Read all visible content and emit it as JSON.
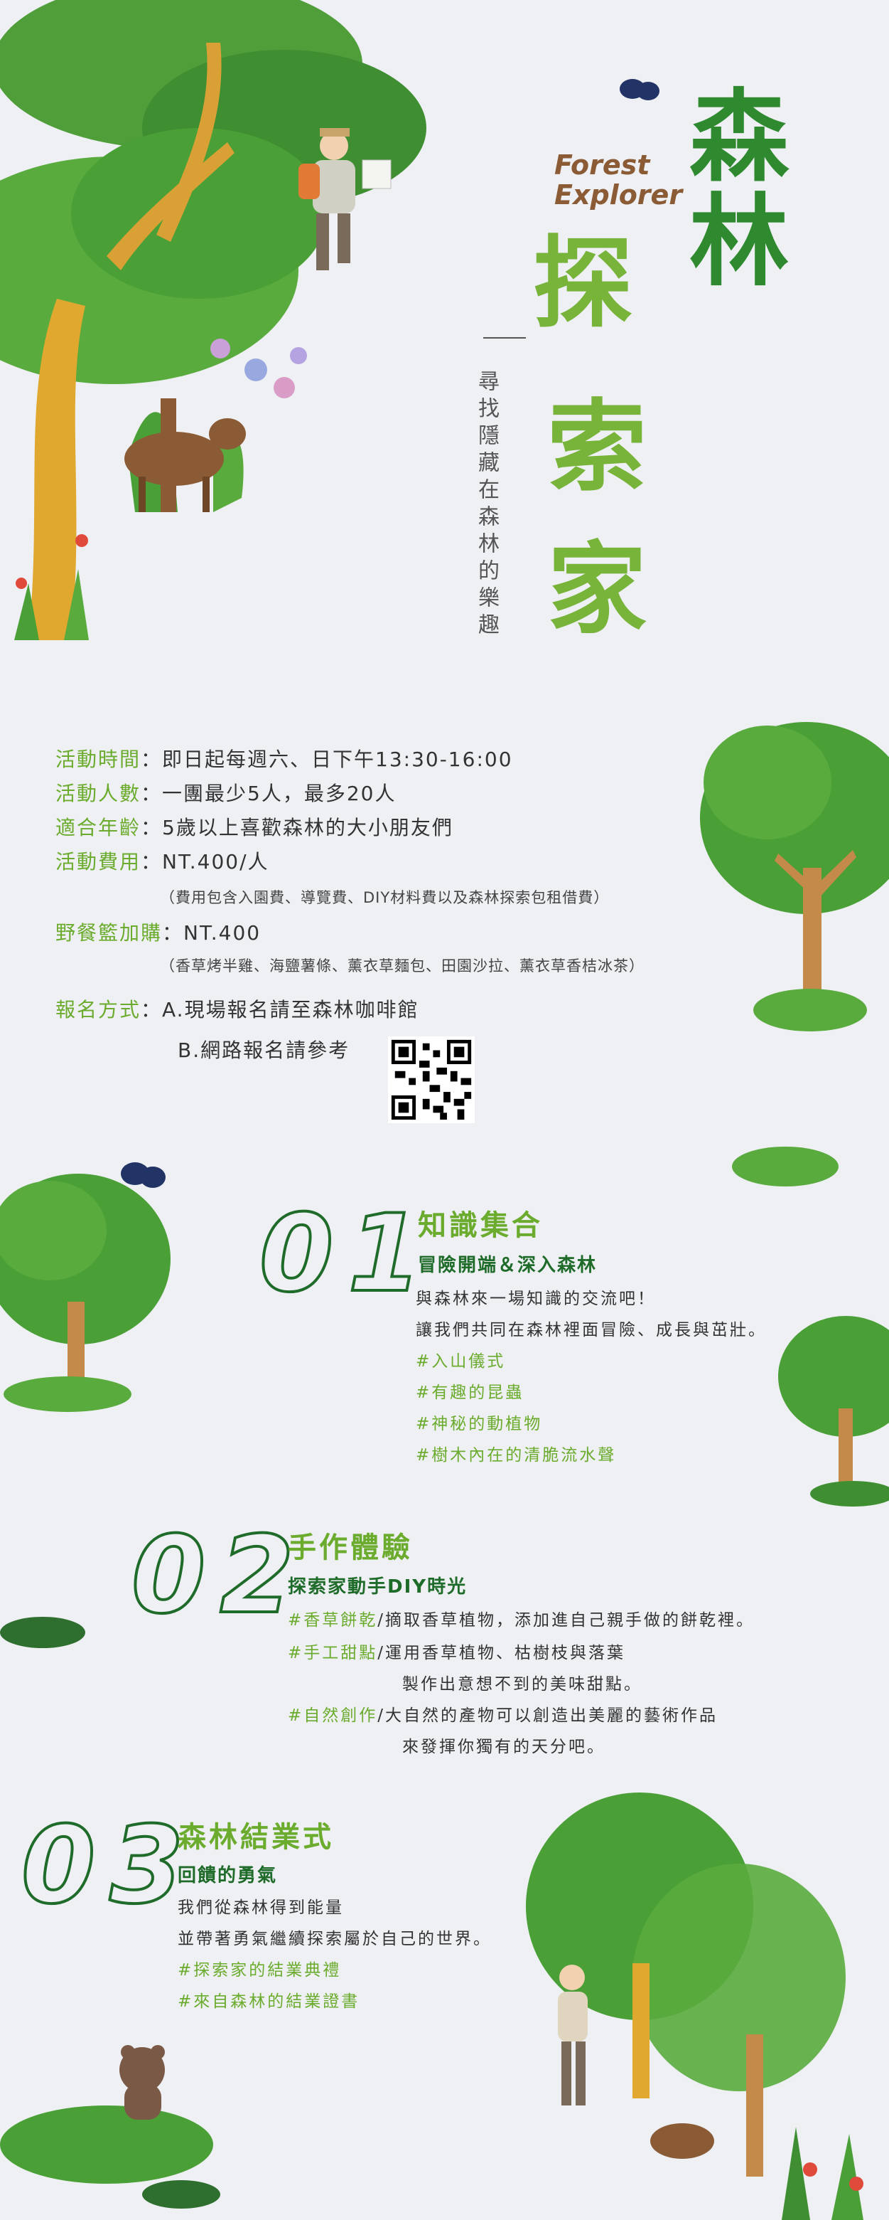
{
  "header": {
    "title_line1": "森林",
    "title_line2a": "探",
    "title_line2b": "索",
    "title_line2c": "家",
    "en_line1": "Forest",
    "en_line2": "Explorer",
    "tagline": "尋找隱藏在森林的樂趣"
  },
  "info": {
    "time_label": "活動時間",
    "time_value": "：即日起每週六、日下午13:30-16:00",
    "people_label": "活動人數",
    "people_value": "：一團最少5人，最多20人",
    "age_label": "適合年齡",
    "age_value": "：5歲以上喜歡森林的大小朋友們",
    "fee_label": "活動費用",
    "fee_value": "：NT.400/人",
    "fee_note": "（費用包含入園費、導覽費、DIY材料費以及森林探索包租借費）",
    "picnic_label": "野餐籃加購",
    "picnic_value": "：NT.400",
    "picnic_note": "（香草烤半雞、海鹽薯條、薰衣草麵包、田園沙拉、薰衣草香桔冰茶）",
    "signup_label": "報名方式",
    "signup_a": "：A.現場報名請至森林咖啡館",
    "signup_b": "B.網路報名請參考"
  },
  "sections": [
    {
      "number": "01",
      "title": "知識集合",
      "subtitle": "冒險開端＆深入森林",
      "lines": [
        "與森林來一場知識的交流吧！",
        "讓我們共同在森林裡面冒險、成長與茁壯。"
      ],
      "tags": [
        "#入山儀式",
        "#有趣的昆蟲",
        "#神秘的動植物",
        "#樹木內在的清脆流水聲"
      ]
    },
    {
      "number": "02",
      "title": "手作體驗",
      "subtitle": "探索家動手DIY時光",
      "items": [
        {
          "tag": "#香草餅乾",
          "text": "/摘取香草植物，添加進自己親手做的餅乾裡。"
        },
        {
          "tag": "#手工甜點",
          "text": "/運用香草植物、枯樹枝與落葉",
          "cont": "製作出意想不到的美味甜點。"
        },
        {
          "tag": "#自然創作",
          "text": "/大自然的產物可以創造出美麗的藝術作品",
          "cont": "來發揮你獨有的天分吧。"
        }
      ]
    },
    {
      "number": "03",
      "title": "森林結業式",
      "subtitle": "回饋的勇氣",
      "lines": [
        "我們從森林得到能量",
        "並帶著勇氣繼續探索屬於自己的世界。"
      ],
      "tags": [
        "#探索家的結業典禮",
        "#來自森林的結業證書"
      ]
    }
  ],
  "colors": {
    "dark_green": "#1f6b2a",
    "title_green": "#2f8a2f",
    "light_green": "#6bab2d",
    "brown": "#8a5b34",
    "background": "#eef0f4"
  }
}
